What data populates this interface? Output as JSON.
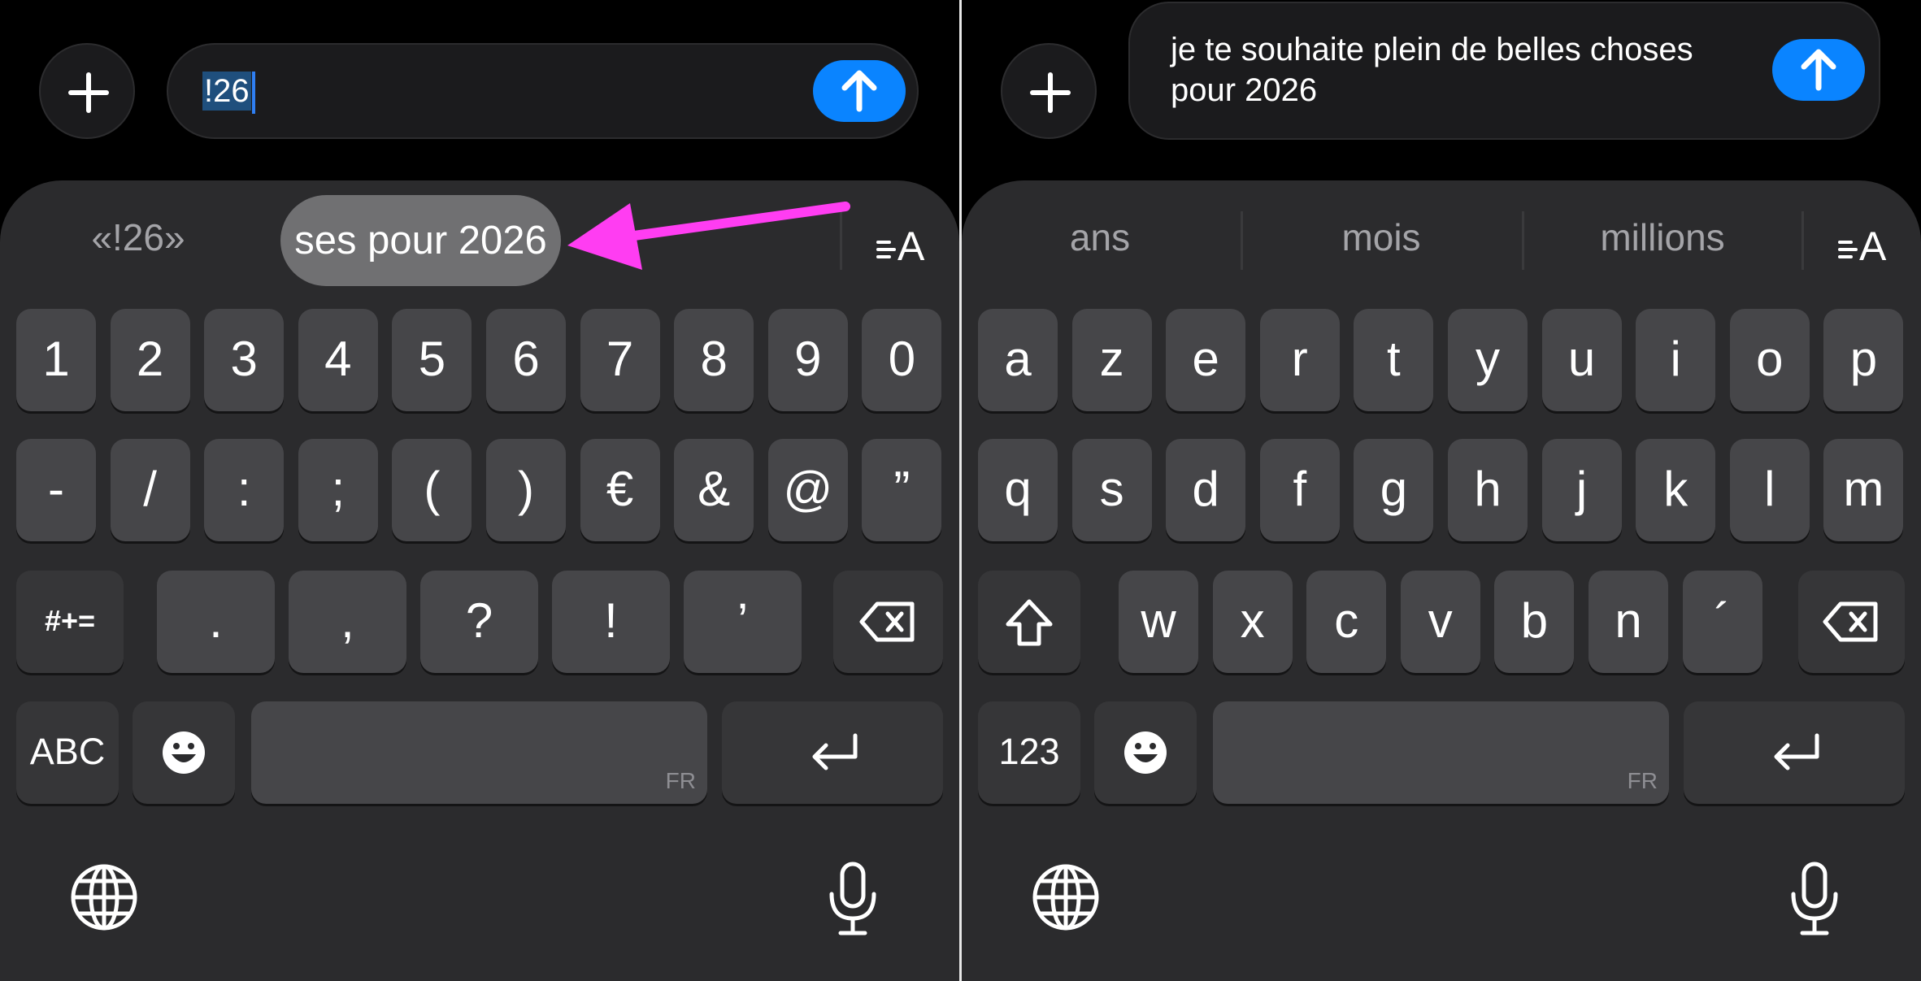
{
  "left": {
    "input": {
      "value": "!26"
    },
    "suggestions": {
      "quoted": "«!26»",
      "highlighted": "ses pour 2026"
    },
    "rows": [
      [
        "1",
        "2",
        "3",
        "4",
        "5",
        "6",
        "7",
        "8",
        "9",
        "0"
      ],
      [
        "-",
        "/",
        ":",
        ";",
        "(",
        ")",
        "€",
        "&",
        "@",
        "”"
      ],
      [
        ".",
        ",",
        "?",
        "!",
        "’"
      ]
    ],
    "special": {
      "symbols": "#+=",
      "abc": "ABC",
      "lang": "FR"
    }
  },
  "right": {
    "input": {
      "value": "je te souhaite plein de belles choses\npour 2026"
    },
    "suggestions": [
      "ans",
      "mois",
      "millions"
    ],
    "rows": [
      [
        "a",
        "z",
        "e",
        "r",
        "t",
        "y",
        "u",
        "i",
        "o",
        "p"
      ],
      [
        "q",
        "s",
        "d",
        "f",
        "g",
        "h",
        "j",
        "k",
        "l",
        "m"
      ],
      [
        "w",
        "x",
        "c",
        "v",
        "b",
        "n",
        "´"
      ]
    ],
    "special": {
      "numbers": "123",
      "lang": "FR"
    }
  },
  "colors": {
    "accent": "#0a84ff",
    "annotation_arrow": "#ff3df2",
    "key": "#464649",
    "keyboard_bg": "#2b2b2d"
  },
  "icons": [
    "plus-icon",
    "send-arrow-icon",
    "format-text-icon",
    "delete-icon",
    "emoji-icon",
    "return-icon",
    "globe-icon",
    "microphone-icon",
    "shift-icon"
  ]
}
